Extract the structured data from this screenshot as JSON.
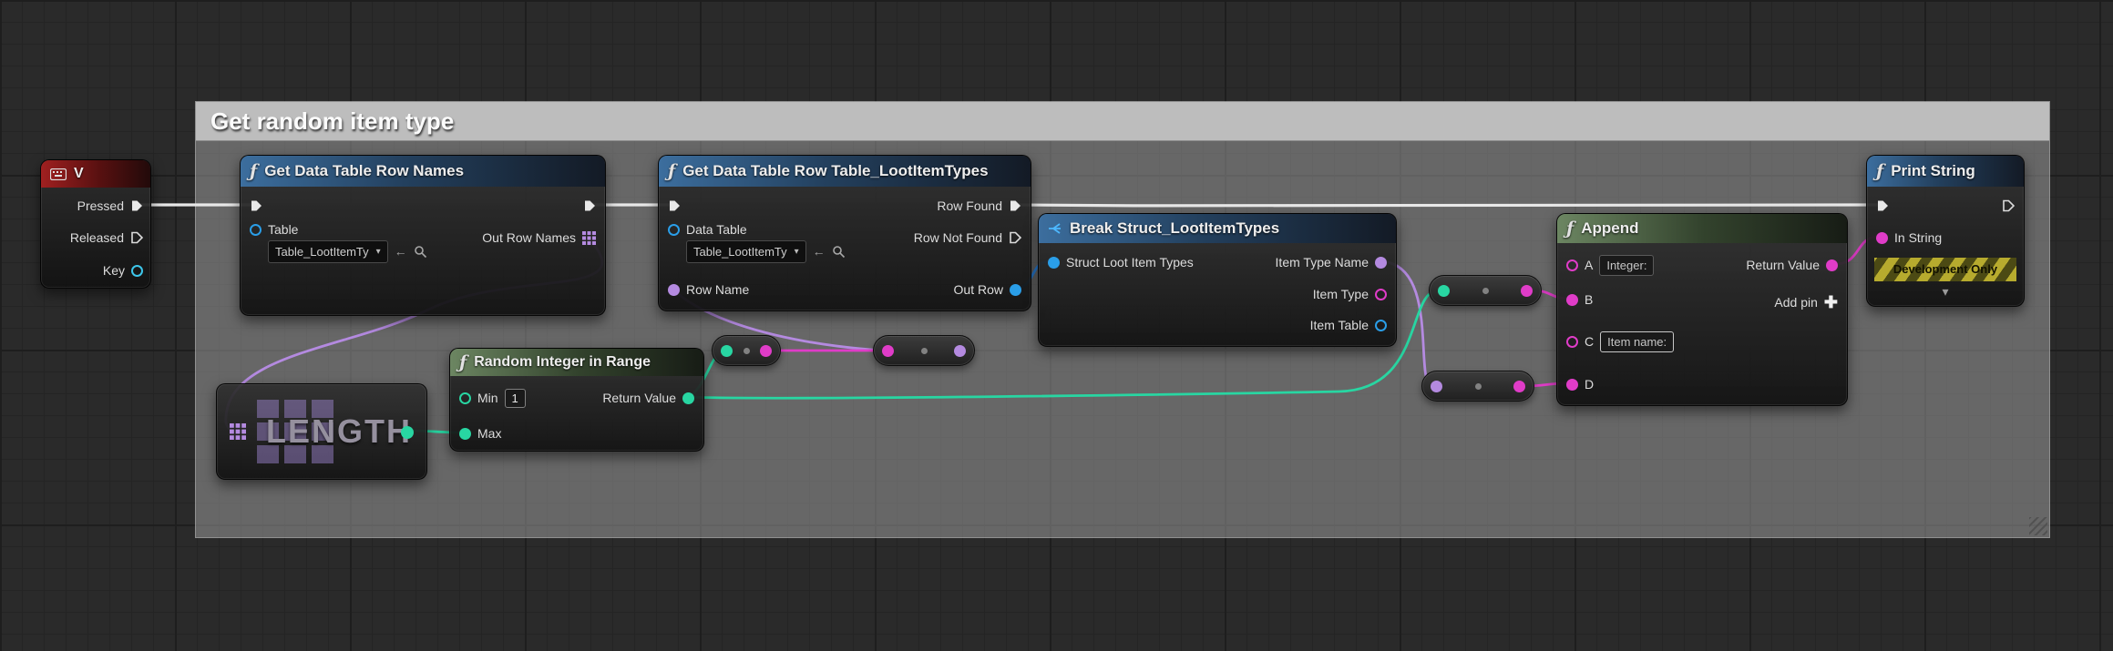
{
  "comment": {
    "title": "Get random item type"
  },
  "nodes": {
    "v_event": {
      "title": "V",
      "pins": {
        "pressed": "Pressed",
        "released": "Released",
        "key": "Key"
      }
    },
    "get_data_table_row_names": {
      "title": "Get Data Table Row Names",
      "table_value": "Table_LootItemTy",
      "pins": {
        "table": "Table",
        "out_row_names": "Out Row Names"
      }
    },
    "get_data_table_row": {
      "title": "Get Data Table Row Table_LootItemTypes",
      "data_table_value": "Table_LootItemTy",
      "pins": {
        "data_table": "Data Table",
        "row_name": "Row Name",
        "row_found": "Row Found",
        "row_not_found": "Row Not Found",
        "out_row": "Out Row"
      }
    },
    "break_struct": {
      "title": "Break Struct_LootItemTypes",
      "pins": {
        "input": "Struct Loot Item Types",
        "item_type_name": "Item Type Name",
        "item_type": "Item Type",
        "item_table": "Item Table"
      }
    },
    "append": {
      "title": "Append",
      "a_value": "Integer:",
      "c_value": "Item name:",
      "pins": {
        "a": "A",
        "b": "B",
        "c": "C",
        "d": "D",
        "return_value": "Return Value",
        "add_pin": "Add pin"
      }
    },
    "print_string": {
      "title": "Print String",
      "banner": "Development Only",
      "pins": {
        "in_string": "In String"
      }
    },
    "random_integer_in_range": {
      "title": "Random Integer in Range",
      "min_value": "1",
      "pins": {
        "min": "Min",
        "max": "Max",
        "return_value": "Return Value"
      }
    },
    "array_length": {
      "title": "LENGTH"
    }
  },
  "colors": {
    "exec": "#e8e8e8",
    "string_pin": "#e03cc8",
    "name_pin": "#b48ae0",
    "int_pin": "#28d6a2",
    "object_pin": "#2a9ee8",
    "event_header": "#a02020",
    "function_header": "#3c6e9e",
    "pure_header": "#6c8662"
  }
}
